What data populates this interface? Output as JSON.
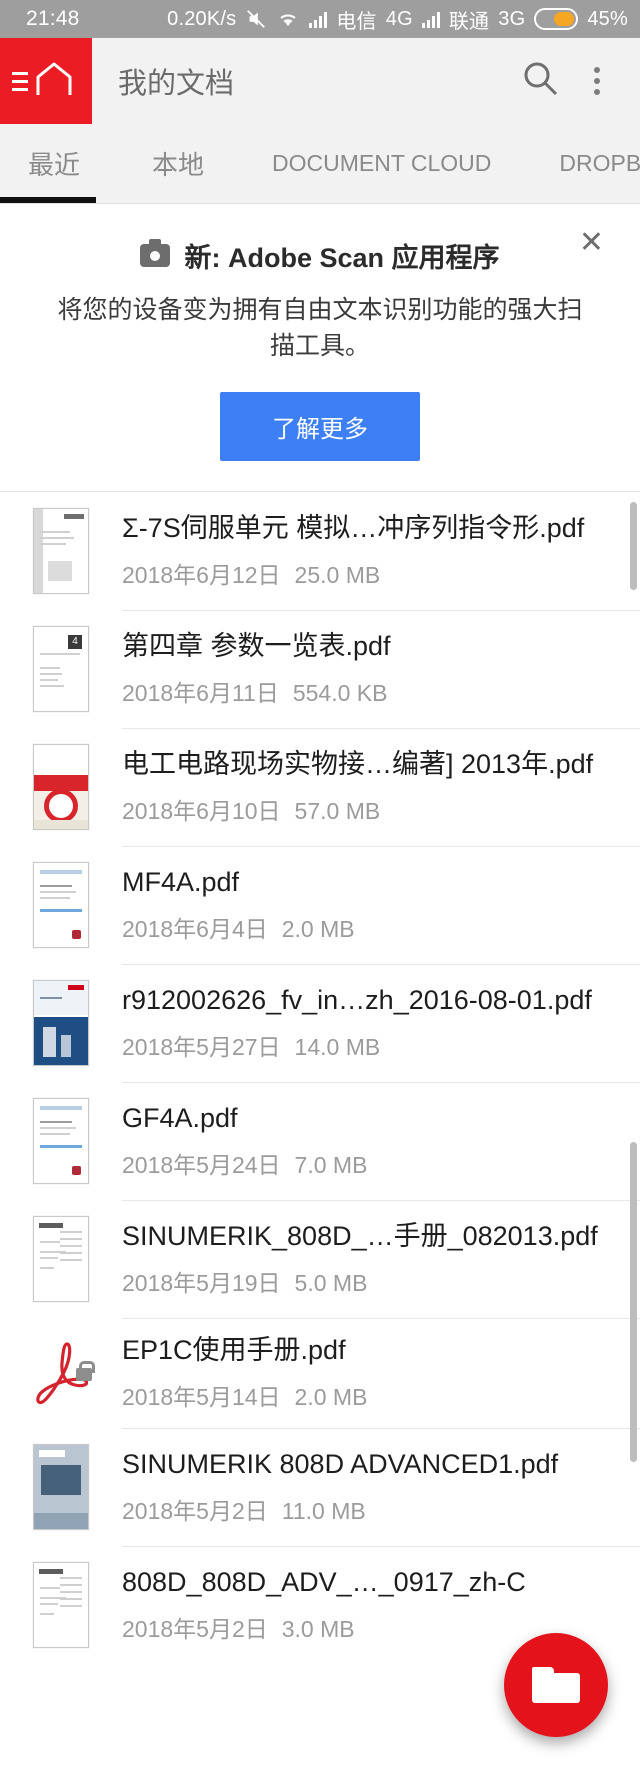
{
  "statusbar": {
    "time": "21:48",
    "net_speed": "0.20K/s",
    "carrier1": "电信",
    "net1": "4G",
    "carrier2": "联通",
    "net2": "3G",
    "battery": "45%",
    "icons": [
      "mute-icon",
      "wifi-icon",
      "signal-bars-icon",
      "signal-bars-icon",
      "battery-icon"
    ]
  },
  "appbar": {
    "title": "我的文档",
    "home_icon": "home-icon",
    "menu_icon": "hamburger-menu-icon",
    "search_icon": "search-icon",
    "overflow_icon": "kebab-menu-icon"
  },
  "tabs": {
    "items": [
      {
        "label": "最近",
        "active": true
      },
      {
        "label": "本地",
        "active": false
      },
      {
        "label": "DOCUMENT CLOUD",
        "active": false
      },
      {
        "label": "DROPBOX",
        "active": false
      }
    ]
  },
  "promo": {
    "icon": "camera-icon",
    "title": "新: Adobe Scan 应用程序",
    "description": "将您的设备变为拥有自由文本识别功能的强大扫描工具。",
    "button_label": "了解更多",
    "close_icon": "close-icon",
    "button_color": "#3d7ff4"
  },
  "files": [
    {
      "name": "Σ-7S伺服单元 模拟…冲序列指令形.pdf",
      "date": "2018年6月12日",
      "size": "25.0 MB",
      "thumb": "th-sigma",
      "locked": false
    },
    {
      "name": "第四章 参数一览表.pdf",
      "date": "2018年6月11日",
      "size": "554.0 KB",
      "thumb": "th-ch4",
      "locked": false
    },
    {
      "name": "电工电路现场实物接…编著] 2013年.pdf",
      "date": "2018年6月10日",
      "size": "57.0 MB",
      "thumb": "th-book",
      "locked": false
    },
    {
      "name": "MF4A.pdf",
      "date": "2018年6月4日",
      "size": "2.0 MB",
      "thumb": "th-mf",
      "locked": false
    },
    {
      "name": "r912002626_fv_in…zh_2016-08-01.pdf",
      "date": "2018年5月27日",
      "size": "14.0 MB",
      "thumb": "th-rex",
      "locked": false
    },
    {
      "name": "GF4A.pdf",
      "date": "2018年5月24日",
      "size": "7.0 MB",
      "thumb": "th-mf",
      "locked": false
    },
    {
      "name": "SINUMERIK_808D_…手册_082013.pdf",
      "date": "2018年5月19日",
      "size": "5.0 MB",
      "thumb": "th-sie",
      "locked": false
    },
    {
      "name": "EP1C使用手册.pdf",
      "date": "2018年5月14日",
      "size": "2.0 MB",
      "thumb": "adobe-pdf-icon",
      "locked": true
    },
    {
      "name": "SINUMERIK 808D ADVANCED1.pdf",
      "date": "2018年5月2日",
      "size": "11.0 MB",
      "thumb": "th-adv",
      "locked": false
    },
    {
      "name": "808D_808D_ADV_…_0917_zh-C",
      "date": "2018年5月2日",
      "size": "3.0 MB",
      "thumb": "th-sie",
      "locked": false
    }
  ],
  "fab": {
    "icon": "folder-icon",
    "color": "#e4121b"
  }
}
